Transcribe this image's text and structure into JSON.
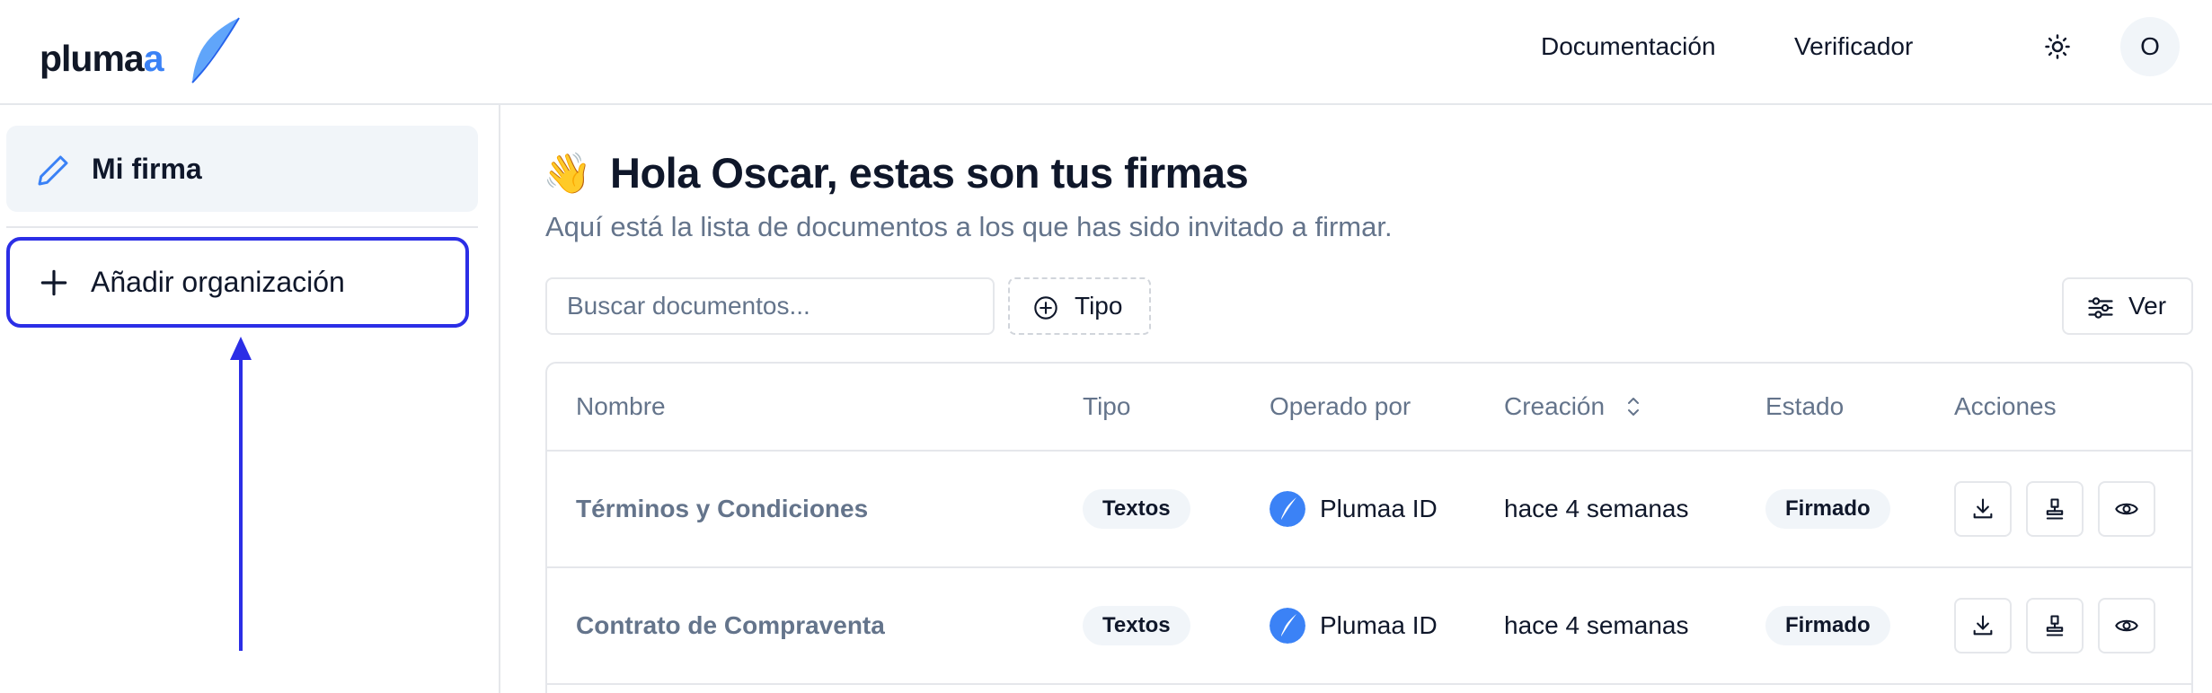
{
  "header": {
    "logo_text": "pluma",
    "logo_accent": "a",
    "nav": {
      "docs": "Documentación",
      "verifier": "Verificador"
    },
    "theme_icon": "sun-icon",
    "avatar_initial": "O"
  },
  "sidebar": {
    "items": [
      {
        "label": "Mi firma",
        "icon": "pen-icon",
        "active": true
      },
      {
        "label": "Añadir organización",
        "icon": "plus-icon",
        "highlighted": true
      }
    ],
    "annotation": "arrow-up"
  },
  "main": {
    "wave_emoji": "👋",
    "title": "Hola Oscar, estas son tus firmas",
    "subtitle": "Aquí está la lista de documentos a los que has sido invitado a firmar.",
    "search": {
      "placeholder": "Buscar documentos...",
      "value": ""
    },
    "type_filter": "Tipo",
    "view_button": "Ver",
    "table": {
      "columns": {
        "name": "Nombre",
        "type": "Tipo",
        "operated_by": "Operado por",
        "created": "Creación",
        "state": "Estado",
        "actions": "Acciones"
      },
      "rows": [
        {
          "name": "Términos y Condiciones",
          "type": "Textos",
          "operated_by": "Plumaa ID",
          "created": "hace 4 semanas",
          "state": "Firmado"
        },
        {
          "name": "Contrato de Compraventa",
          "type": "Textos",
          "operated_by": "Plumaa ID",
          "created": "hace 4 semanas",
          "state": "Firmado"
        }
      ]
    }
  },
  "colors": {
    "accent": "#3b82f6",
    "highlight_border": "#2b2ee6",
    "muted_text": "#64748b",
    "badge_bg": "#f1f5f9"
  }
}
